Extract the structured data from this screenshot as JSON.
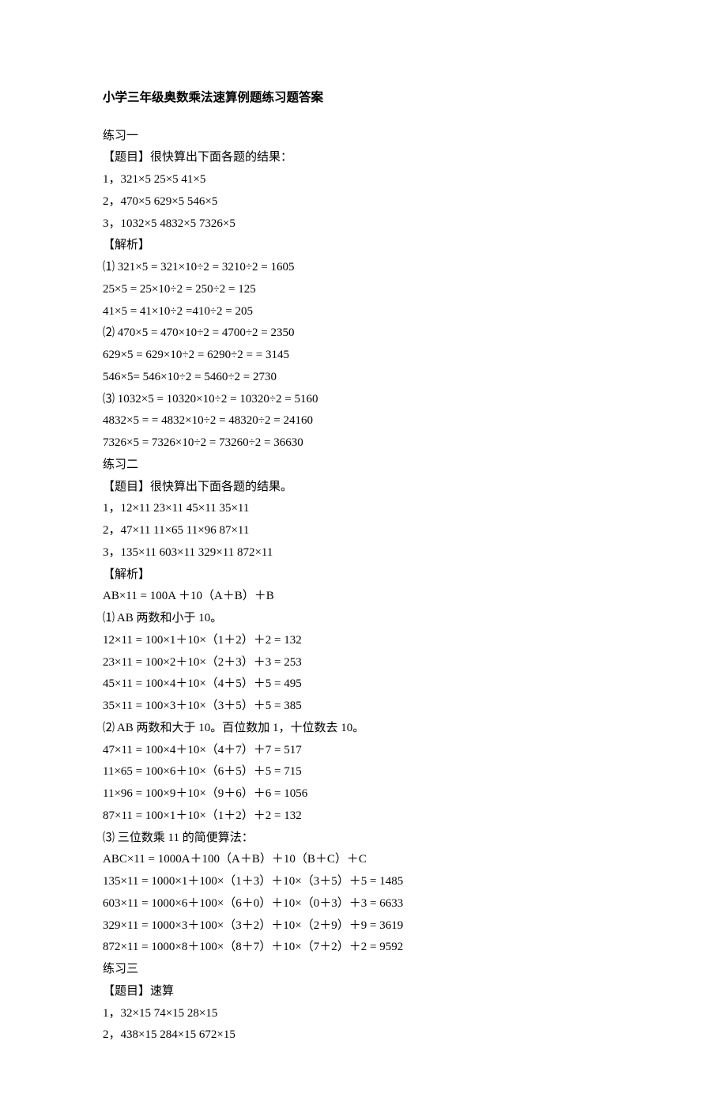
{
  "title": "小学三年级奥数乘法速算例题练习题答案",
  "lines": [
    "练习一",
    "【题目】很快算出下面各题的结果：",
    "1，321×5 25×5 41×5",
    "2，470×5 629×5 546×5",
    "3，1032×5 4832×5 7326×5",
    "【解析】",
    "⑴ 321×5 = 321×10÷2 = 3210÷2 = 1605",
    "25×5 = 25×10÷2 = 250÷2 = 125",
    "41×5 = 41×10÷2 =410÷2 = 205",
    "⑵ 470×5 = 470×10÷2 = 4700÷2 = 2350",
    "629×5 = 629×10÷2 = 6290÷2 = = 3145",
    "546×5= 546×10÷2 = 5460÷2 = 2730",
    "⑶ 1032×5 = 10320×10÷2 = 10320÷2 = 5160",
    "4832×5 = = 4832×10÷2 = 48320÷2 = 24160",
    "7326×5 = 7326×10÷2 = 73260÷2 = 36630",
    "练习二",
    "【题目】很快算出下面各题的结果。",
    "1，12×11 23×11 45×11 35×11",
    "2，47×11 11×65 11×96 87×11",
    "3，135×11 603×11 329×11 872×11",
    "【解析】",
    "AB×11 = 100A ＋10（A＋B）＋B",
    "⑴ AB 两数和小于 10。",
    "12×11 = 100×1＋10×（1＋2）＋2 = 132",
    "23×11 = 100×2＋10×（2＋3）＋3 = 253",
    "45×11 = 100×4＋10×（4＋5）＋5 = 495",
    "35×11 = 100×3＋10×（3＋5）＋5 = 385",
    "⑵ AB 两数和大于 10。百位数加 1，十位数去 10。",
    "47×11 = 100×4＋10×（4＋7）＋7 = 517",
    "11×65 = 100×6＋10×（6＋5）＋5 = 715",
    "11×96 = 100×9＋10×（9＋6）＋6 = 1056",
    "87×11 = 100×1＋10×（1＋2）＋2 = 132",
    "⑶ 三位数乘 11 的简便算法：",
    "ABC×11 = 1000A＋100（A＋B）＋10（B＋C）＋C",
    "135×11 = 1000×1＋100×（1＋3）＋10×（3＋5）＋5 = 1485",
    "603×11 = 1000×6＋100×（6＋0）＋10×（0＋3）＋3 = 6633",
    "329×11 = 1000×3＋100×（3＋2）＋10×（2＋9）＋9 = 3619",
    "872×11 = 1000×8＋100×（8＋7）＋10×（7＋2）＋2 = 9592",
    "练习三",
    "【题目】速算",
    "1，32×15 74×15 28×15",
    "2，438×15 284×15 672×15"
  ]
}
